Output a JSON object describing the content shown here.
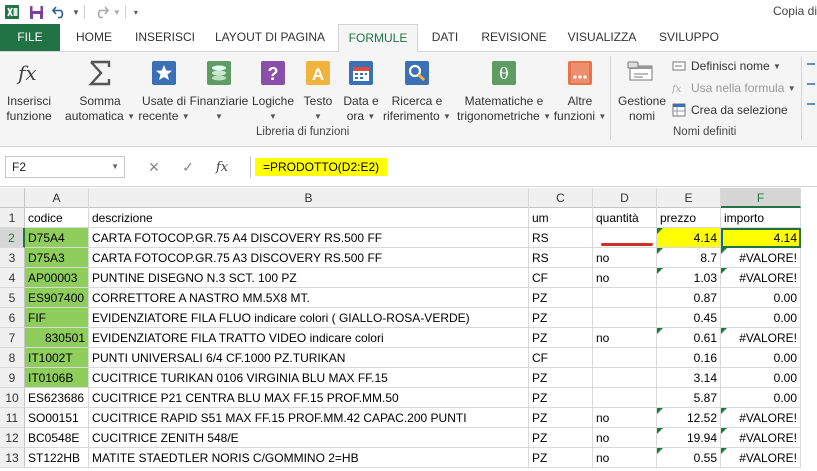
{
  "window": {
    "title": "Copia di"
  },
  "tabs": [
    {
      "label": "FILE"
    },
    {
      "label": "HOME"
    },
    {
      "label": "INSERISCI"
    },
    {
      "label": "LAYOUT DI PAGINA"
    },
    {
      "label": "FORMULE"
    },
    {
      "label": "DATI"
    },
    {
      "label": "REVISIONE"
    },
    {
      "label": "VISUALIZZA"
    },
    {
      "label": "SVILUPPO"
    }
  ],
  "ribbon": {
    "insert_function": {
      "line1": "Inserisci",
      "line2": "funzione",
      "icon": "fx-icon"
    },
    "autosum": {
      "line1": "Somma",
      "line2": "automatica",
      "icon": "sigma-icon"
    },
    "recent": {
      "line1": "Usate di",
      "line2": "recente",
      "icon": "star-icon"
    },
    "financial": {
      "line1": "Finanziarie",
      "icon": "coins-icon"
    },
    "logical": {
      "line1": "Logiche",
      "icon": "question-icon"
    },
    "text": {
      "line1": "Testo",
      "icon": "text-a-icon"
    },
    "datetime": {
      "line1": "Data e",
      "line2": "ora",
      "icon": "calendar-icon"
    },
    "lookup": {
      "line1": "Ricerca e",
      "line2": "riferimento",
      "icon": "magnifier-icon"
    },
    "math": {
      "line1": "Matematiche e",
      "line2": "trigonometriche",
      "icon": "theta-icon"
    },
    "more": {
      "line1": "Altre",
      "line2": "funzioni",
      "icon": "more-functions-icon"
    },
    "name_manager": {
      "line1": "Gestione",
      "line2": "nomi",
      "icon": "name-manager-icon"
    },
    "define_name": "Definisci nome",
    "use_in_formula": "Usa nella formula",
    "create_from_selection": "Crea da selezione",
    "group_library": "Libreria di funzioni",
    "group_names": "Nomi definiti"
  },
  "formula_bar": {
    "name_box": "F2",
    "formula": "=PRODOTTO(D2:E2)"
  },
  "columns": [
    "A",
    "B",
    "C",
    "D",
    "E",
    "F"
  ],
  "header_row": {
    "row": "1",
    "a": "codice",
    "b": "descrizione",
    "c": "um",
    "d": "quantità",
    "e": "prezzo",
    "f": "importo"
  },
  "rows": [
    {
      "row": "2",
      "a": "D75A4",
      "b": "CARTA FOTOCOP.GR.75 A4 DISCOVERY RS.500 FF",
      "c": "RS",
      "d": "",
      "e": "4.14",
      "f": "4.14"
    },
    {
      "row": "3",
      "a": "D75A3",
      "b": "CARTA FOTOCOP.GR.75 A3 DISCOVERY RS.500 FF",
      "c": "RS",
      "d": "no",
      "e": "8.7",
      "f": "#VALORE!"
    },
    {
      "row": "4",
      "a": "AP00003",
      "b": "PUNTINE DISEGNO N.3 SCT. 100 PZ",
      "c": "CF",
      "d": "no",
      "e": "1.03",
      "f": "#VALORE!"
    },
    {
      "row": "5",
      "a": "ES907400",
      "b": "CORRETTORE A NASTRO MM.5X8 MT.",
      "c": "PZ",
      "d": "",
      "e": "0.87",
      "f": "0.00"
    },
    {
      "row": "6",
      "a": "FIF",
      "b": "EVIDENZIATORE FILA FLUO   indicare colori ( GIALLO-ROSA-VERDE)",
      "c": "PZ",
      "d": "",
      "e": "0.45",
      "f": "0.00"
    },
    {
      "row": "7",
      "a": "830501",
      "b": "EVIDENZIATORE FILA TRATTO VIDEO indicare colori",
      "c": "PZ",
      "d": "no",
      "e": "0.61",
      "f": "#VALORE!"
    },
    {
      "row": "8",
      "a": "IT1002T",
      "b": "PUNTI UNIVERSALI 6/4 CF.1000 PZ.TURIKAN",
      "c": "CF",
      "d": "",
      "e": "0.16",
      "f": "0.00"
    },
    {
      "row": "9",
      "a": "IT0106B",
      "b": "CUCITRICE TURIKAN 0106 VIRGINIA BLU MAX FF.15",
      "c": "PZ",
      "d": "",
      "e": "3.14",
      "f": "0.00"
    },
    {
      "row": "10",
      "a": "ES623686",
      "b": "CUCITRICE P21 CENTRA BLU MAX FF.15 PROF.MM.50",
      "c": "PZ",
      "d": "",
      "e": "5.87",
      "f": "0.00"
    },
    {
      "row": "11",
      "a": "SO00151",
      "b": "CUCITRICE RAPID S51 MAX FF.15 PROF.MM.42 CAPAC.200 PUNTI",
      "c": "PZ",
      "d": "no",
      "e": "12.52",
      "f": "#VALORE!"
    },
    {
      "row": "12",
      "a": "BC0548E",
      "b": "CUCITRICE ZENITH 548/E",
      "c": "PZ",
      "d": "no",
      "e": "19.94",
      "f": "#VALORE!"
    },
    {
      "row": "13",
      "a": "ST122HB",
      "b": "MATITE STAEDTLER NORIS C/GOMMINO 2=HB",
      "c": "PZ",
      "d": "no",
      "e": "0.55",
      "f": "#VALORE!"
    }
  ],
  "colors": {
    "excel_green": "#217346",
    "code_fill": "#8fce5c",
    "highlight": "#ffff00",
    "error_triangle": "#1e7c3c",
    "annotation_red": "#d12d2d"
  }
}
